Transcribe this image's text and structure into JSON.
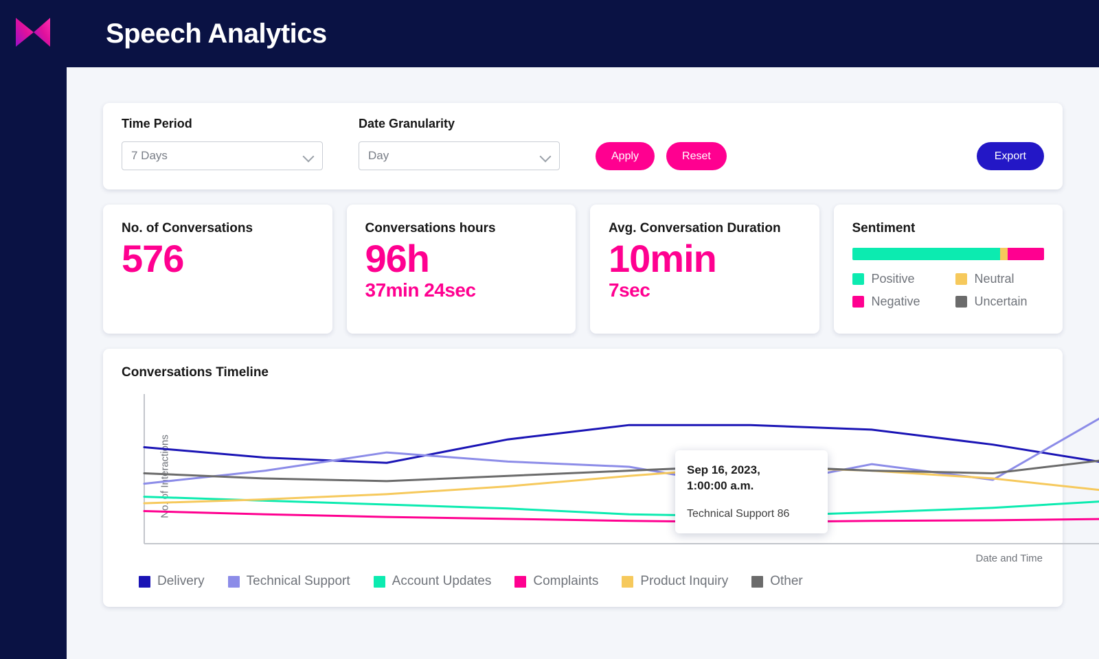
{
  "header": {
    "title": "Speech Analytics",
    "logo_icon": "brand-m-logo"
  },
  "filters": {
    "time_period": {
      "label": "Time Period",
      "value": "7 Days"
    },
    "date_granularity": {
      "label": "Date Granularity",
      "value": "Day"
    },
    "apply_label": "Apply",
    "reset_label": "Reset",
    "export_label": "Export"
  },
  "kpis": [
    {
      "title": "No. of Conversations",
      "value": "576",
      "sub": ""
    },
    {
      "title": "Conversations hours",
      "value": "96h",
      "sub": "37min 24sec"
    },
    {
      "title": "Avg. Conversation Duration",
      "value": "10min",
      "sub": "7sec"
    }
  ],
  "sentiment": {
    "title": "Sentiment",
    "segments": [
      {
        "label": "Positive",
        "color": "#0cebb0",
        "pct": 77
      },
      {
        "label": "Neutral",
        "color": "#f6c95c",
        "pct": 4
      },
      {
        "label": "Negative",
        "color": "#ff0090",
        "pct": 19
      },
      {
        "label": "Uncertain",
        "color": "#6b6b6b",
        "pct": 0
      }
    ],
    "legend": [
      {
        "label": "Positive",
        "color": "#0cebb0"
      },
      {
        "label": "Neutral",
        "color": "#f6c95c"
      },
      {
        "label": "Negative",
        "color": "#ff0090"
      },
      {
        "label": "Uncertain",
        "color": "#6b6b6b"
      }
    ]
  },
  "chart_card": {
    "title": "Conversations Timeline",
    "tooltip": {
      "title": "Sep 16, 2023,\n1:00:00 a.m.",
      "title_line1": "Sep 16, 2023,",
      "title_line2": "1:00:00 a.m.",
      "row": "Technical Support 86"
    }
  },
  "chart_data": {
    "type": "line",
    "title": "Conversations Timeline",
    "xlabel": "Date and Time",
    "ylabel": "No. of Interactions",
    "grid": false,
    "legend_position": "bottom",
    "x_tick_labels": [],
    "y_tick_labels": [],
    "x": [
      0,
      1,
      2,
      3,
      4,
      5,
      6,
      7,
      8
    ],
    "series": [
      {
        "name": "Delivery",
        "color": "#1a14b5",
        "values": [
          148,
          132,
          124,
          160,
          182,
          182,
          175,
          152,
          122
        ]
      },
      {
        "name": "Technical Support",
        "color": "#8c8ce8",
        "values": [
          92,
          112,
          140,
          126,
          118,
          86,
          122,
          98,
          205
        ]
      },
      {
        "name": "Account Updates",
        "color": "#0cebb0",
        "values": [
          72,
          66,
          60,
          54,
          45,
          42,
          48,
          55,
          66
        ]
      },
      {
        "name": "Complaints",
        "color": "#ff0090",
        "values": [
          50,
          45,
          41,
          38,
          35,
          33,
          35,
          36,
          38
        ]
      },
      {
        "name": "Product Inquiry",
        "color": "#f6c95c",
        "values": [
          62,
          68,
          76,
          88,
          104,
          118,
          112,
          100,
          80
        ]
      },
      {
        "name": "Other",
        "color": "#6b6b6b",
        "values": [
          108,
          100,
          96,
          104,
          112,
          120,
          112,
          108,
          130
        ]
      }
    ]
  }
}
